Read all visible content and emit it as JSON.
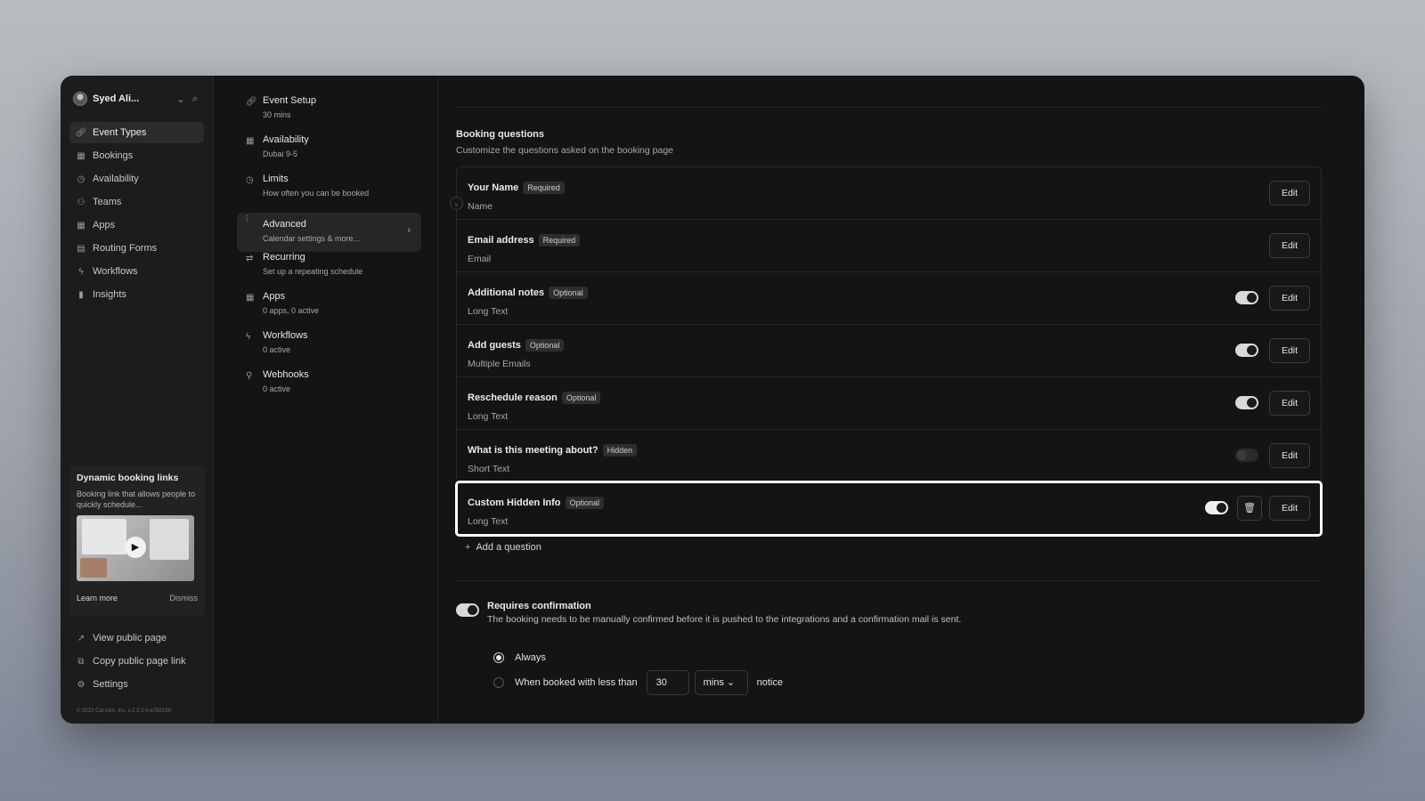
{
  "sidebar": {
    "user_name": "Syed Ali...",
    "items": [
      {
        "label": "Event Types",
        "icon": "link-icon"
      },
      {
        "label": "Bookings",
        "icon": "calendar-icon"
      },
      {
        "label": "Availability",
        "icon": "clock-icon"
      },
      {
        "label": "Teams",
        "icon": "users-icon"
      },
      {
        "label": "Apps",
        "icon": "grid-icon"
      },
      {
        "label": "Routing Forms",
        "icon": "file-icon"
      },
      {
        "label": "Workflows",
        "icon": "zap-icon"
      },
      {
        "label": "Insights",
        "icon": "bar-chart-icon"
      }
    ],
    "promo": {
      "title": "Dynamic booking links",
      "description": "Booking link that allows people to quickly schedule...",
      "learn_more": "Learn more",
      "dismiss": "Dismiss"
    },
    "bottom_items": [
      {
        "label": "View public page",
        "icon": "external-link-icon"
      },
      {
        "label": "Copy public page link",
        "icon": "copy-icon"
      },
      {
        "label": "Settings",
        "icon": "settings-icon"
      }
    ],
    "copyright": "© 2023 Cal.com, Inc. v.2.3.3-h-e782180"
  },
  "steps": [
    {
      "title": "Event Setup",
      "subtitle": "30 mins",
      "icon": "link-icon"
    },
    {
      "title": "Availability",
      "subtitle": "Dubai 9-5",
      "icon": "calendar-icon"
    },
    {
      "title": "Limits",
      "subtitle": "How often you can be booked",
      "icon": "clock-icon"
    },
    {
      "title": "Advanced",
      "subtitle": "Calendar settings & more...",
      "icon": "sliders-icon"
    },
    {
      "title": "Recurring",
      "subtitle": "Set up a repeating schedule",
      "icon": "repeat-icon"
    },
    {
      "title": "Apps",
      "subtitle": "0 apps, 0 active",
      "icon": "grid-icon"
    },
    {
      "title": "Workflows",
      "subtitle": "0 active",
      "icon": "zap-icon"
    },
    {
      "title": "Webhooks",
      "subtitle": "0 active",
      "icon": "webhook-icon"
    }
  ],
  "booking": {
    "title": "Booking questions",
    "description": "Customize the questions asked on the booking page",
    "edit_label": "Edit",
    "questions": [
      {
        "label": "Your Name",
        "badge": "Required",
        "type": "Name"
      },
      {
        "label": "Email address",
        "badge": "Required",
        "type": "Email"
      },
      {
        "label": "Additional notes",
        "badge": "Optional",
        "type": "Long Text",
        "enabled": true
      },
      {
        "label": "Add guests",
        "badge": "Optional",
        "type": "Multiple Emails",
        "enabled": true
      },
      {
        "label": "Reschedule reason",
        "badge": "Optional",
        "type": "Long Text",
        "enabled": true
      },
      {
        "label": "What is this meeting about?",
        "badge": "Hidden",
        "type": "Short Text",
        "enabled": false
      },
      {
        "label": "Custom Hidden Info",
        "badge": "Optional",
        "type": "Long Text",
        "enabled": true
      }
    ],
    "add_question": "Add a question"
  },
  "confirmation": {
    "title": "Requires confirmation",
    "description": "The booking needs to be manually confirmed before it is pushed to the integrations and a confirmation mail is sent.",
    "option_always": "Always",
    "option_less_than": "When booked with less than",
    "notice_value": "30",
    "unit": "mins",
    "notice_suffix": "notice"
  }
}
